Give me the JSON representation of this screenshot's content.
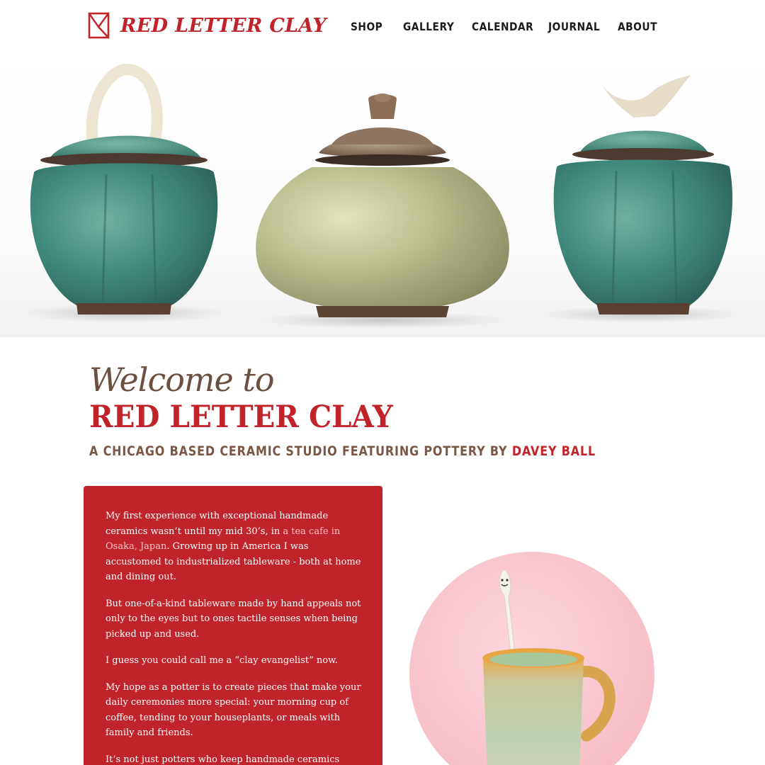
{
  "brand": {
    "name": "RED LETTER CLAY",
    "color": "#c1232a",
    "logo_icon": "envelope-logo-icon"
  },
  "nav": {
    "items": [
      {
        "label": "SHOP"
      },
      {
        "label": "GALLERY"
      },
      {
        "label": "CALENDAR"
      },
      {
        "label": "JOURNAL"
      },
      {
        "label": "ABOUT"
      }
    ]
  },
  "hero": {
    "image": "three-lidded-ceramic-jars-photo"
  },
  "welcome": {
    "intro": "Welcome to",
    "title": "RED LETTER CLAY",
    "tagline_prefix": "A CHICAGO BASED CERAMIC STUDIO FEATURING POTTERY BY ",
    "tagline_artist": "DAVEY BALL"
  },
  "story": {
    "p1_before": "My first experience with exceptional handmade ceramics wasn’t until my mid 30’s, in ",
    "p1_link": "a tea cafe in Osaka, Japan",
    "p1_after": ". Growing up in America I was accustomed to industrialized tableware - both at home and dining out.",
    "p2": "But one-of-a-kind tableware made by hand appeals not only to the eyes but to ones tactile senses when being picked up and used.",
    "p3": "I guess you could call me a “clay evangelist” now.",
    "p4": "My hope as a potter is to create pieces that make your daily ceremonies more special: your morning cup of coffee, tending to your houseplants, or meals with family and friends.",
    "p5": "It’s not just potters who keep handmade ceramics alive, it’s the people who use and enjoy them too."
  },
  "feature_image": {
    "image": "mug-with-spoon-photo"
  },
  "colors": {
    "brand_red": "#c1232a",
    "brown": "#6b5041",
    "card_red": "#c0242a",
    "pink": "#f8c2cb"
  }
}
